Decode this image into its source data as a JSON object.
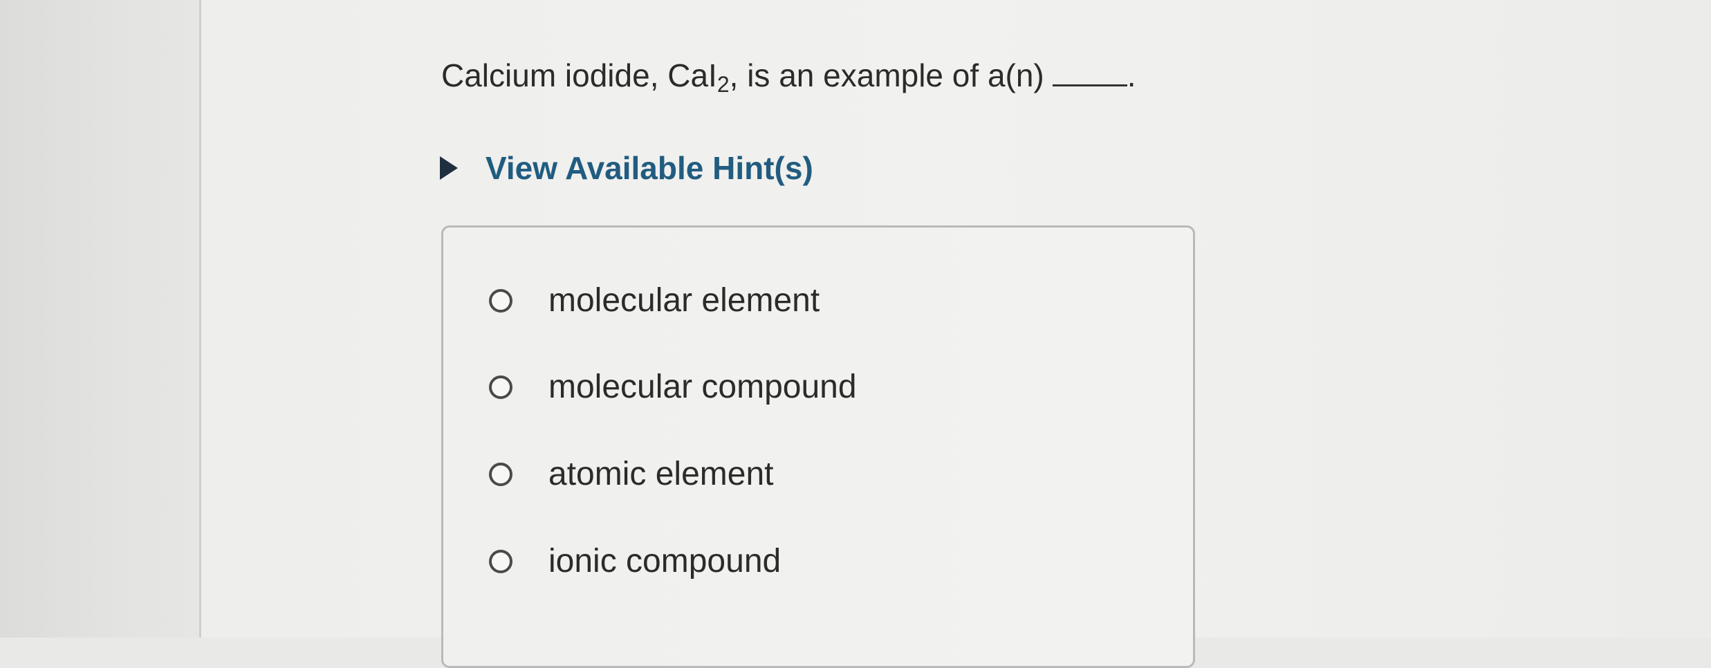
{
  "question": {
    "prefix": "Calcium iodide, CaI",
    "subscript": "2",
    "suffix": ", is an example of a(n)",
    "blank_end": "."
  },
  "hint": {
    "label": "View Available Hint(s)"
  },
  "options": [
    {
      "label": "molecular element",
      "selected": false
    },
    {
      "label": "molecular compound",
      "selected": false
    },
    {
      "label": "atomic element",
      "selected": false
    },
    {
      "label": "ionic compound",
      "selected": false
    }
  ]
}
